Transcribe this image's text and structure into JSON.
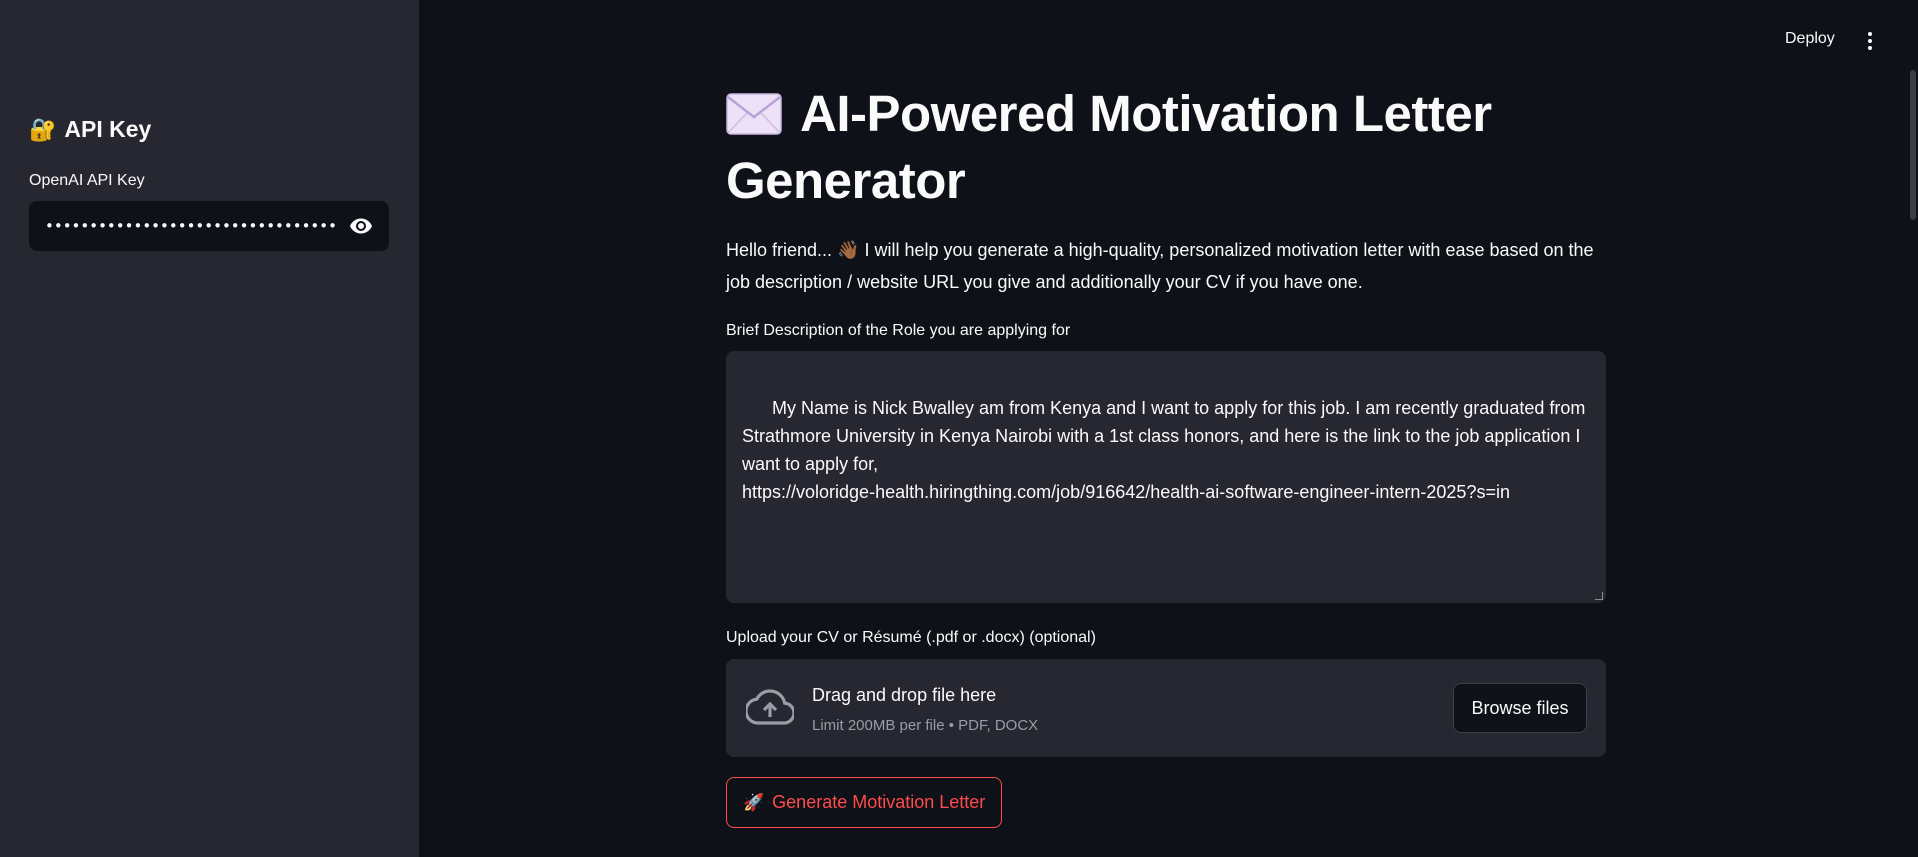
{
  "header": {
    "deploy_label": "Deploy"
  },
  "sidebar": {
    "title": "API Key",
    "title_emoji": "🔐",
    "api_key_label": "OpenAI API Key",
    "api_key_value": "sk-proj-xxxxxxxxxxxxxxxxxxxxxxxxxxxxxxxxxxxxxxxxxxxxxxxxxxxx"
  },
  "main": {
    "title": "AI-Powered Motivation Letter Generator",
    "intro": "Hello friend... 👋🏾 I will help you generate a high-quality, personalized motivation letter with ease based on the job description / website URL you give and additionally your CV if you have one.",
    "role_label": "Brief Description of the Role you are applying for",
    "role_value": "My Name is Nick Bwalley am from Kenya and I want to apply for this job. I am recently graduated from Strathmore University in Kenya Nairobi with a 1st class honors, and here is the link to the job application I want to apply for,\nhttps://voloridge-health.hiringthing.com/job/916642/health-ai-software-engineer-intern-2025?s=in",
    "upload_label": "Upload your CV or Résumé (.pdf or .docx) (optional)",
    "drop_title": "Drag and drop file here",
    "drop_limit": "Limit 200MB per file • PDF, DOCX",
    "browse_label": "Browse files",
    "generate_emoji": "🚀",
    "generate_label": "Generate Motivation Letter"
  },
  "colors": {
    "background": "#0e1117",
    "sidebar": "#262730",
    "accent": "#ff4b4b"
  }
}
